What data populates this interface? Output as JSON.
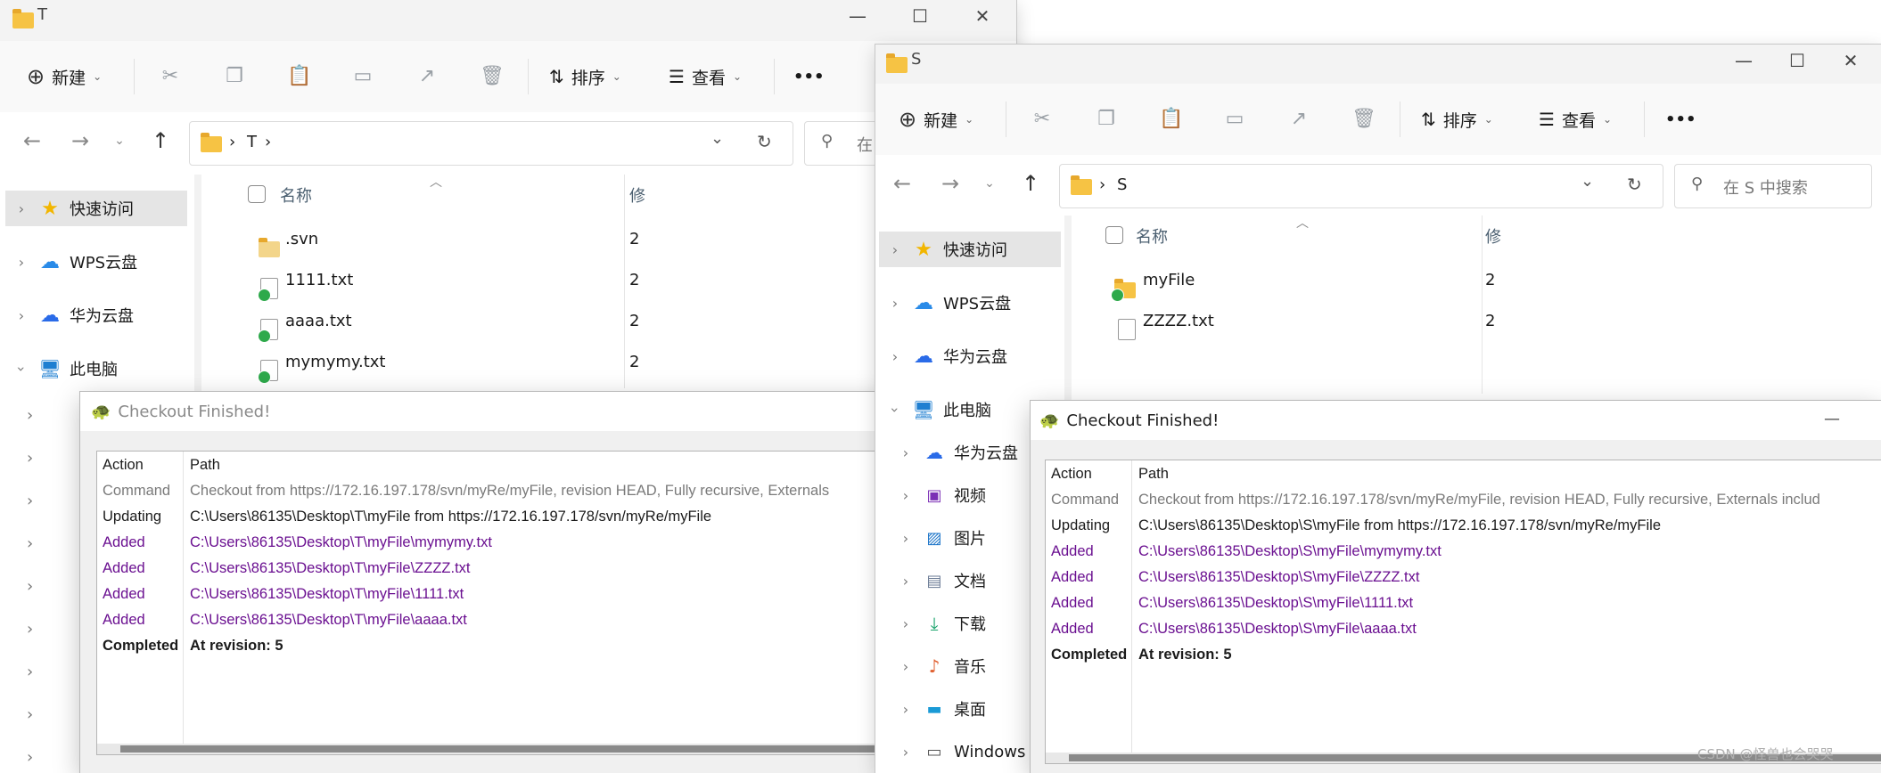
{
  "icons": {
    "new": "plus-circle-icon",
    "cut": "scissors-icon",
    "copy": "copy-icon",
    "paste": "paste-icon",
    "rename": "rename-icon",
    "share": "share-icon",
    "delete": "trash-icon",
    "sort": "sort-icon",
    "view": "view-icon",
    "more": "more-icon",
    "folder": "folder-icon",
    "tortoise": "tortoise-icon"
  },
  "explorerT": {
    "title": "T",
    "toolbar": {
      "new_label": "新建",
      "sort_label": "排序",
      "view_label": "查看",
      "more_label": "•••"
    },
    "window_controls": {
      "minimize": "—",
      "maximize": "☐",
      "close": "✕"
    },
    "address": {
      "crumb_sep": "›",
      "folder": "T",
      "trailing": "›"
    },
    "search_partial": "在",
    "sidebar": [
      {
        "label": "快速访问",
        "icon": "star-icon"
      },
      {
        "label": "WPS云盘",
        "icon": "cloud-icon"
      },
      {
        "label": "华为云盘",
        "icon": "cloud-icon"
      },
      {
        "label": "此电脑",
        "icon": "computer-icon"
      }
    ],
    "column_name": "名称",
    "column_partial": "修",
    "files": [
      {
        "name": ".svn",
        "type": "folder",
        "col2": "2"
      },
      {
        "name": "1111.txt",
        "type": "file",
        "col2": "2"
      },
      {
        "name": "aaaa.txt",
        "type": "file",
        "col2": "2"
      },
      {
        "name": "mymymy.txt",
        "type": "file",
        "col2": "2"
      }
    ]
  },
  "explorerS": {
    "title": "S",
    "toolbar": {
      "new_label": "新建",
      "sort_label": "排序",
      "view_label": "查看",
      "more_label": "•••"
    },
    "window_controls": {
      "minimize": "—",
      "maximize": "☐",
      "close": "✕"
    },
    "address": {
      "crumb_sep": "›",
      "folder": "S"
    },
    "search_placeholder": "在 S 中搜索",
    "sidebar": [
      {
        "label": "快速访问"
      },
      {
        "label": "WPS云盘"
      },
      {
        "label": "华为云盘"
      },
      {
        "label": "此电脑"
      },
      {
        "label": "华为云盘"
      },
      {
        "label": "视频"
      },
      {
        "label": "图片"
      },
      {
        "label": "文档"
      },
      {
        "label": "下载"
      },
      {
        "label": "音乐"
      },
      {
        "label": "桌面"
      },
      {
        "label": "Windows ("
      }
    ],
    "column_name": "名称",
    "column_partial": "修",
    "files": [
      {
        "name": "myFile",
        "type": "folder",
        "col2": "2"
      },
      {
        "name": "ZZZZ.txt",
        "type": "file",
        "col2": "2"
      }
    ]
  },
  "dialogT": {
    "title": "Checkout Finished!",
    "header": {
      "action": "Action",
      "path": "Path"
    },
    "rows": [
      {
        "action": "Command",
        "path": "Checkout from https://172.16.197.178/svn/myRe/myFile, revision HEAD, Fully recursive, Externals",
        "style": "muted"
      },
      {
        "action": "Updating",
        "path": "C:\\Users\\86135\\Desktop\\T\\myFile from https://172.16.197.178/svn/myRe/myFile",
        "style": "normal"
      },
      {
        "action": "Added",
        "path": "C:\\Users\\86135\\Desktop\\T\\myFile\\mymymy.txt",
        "style": "purple"
      },
      {
        "action": "Added",
        "path": "C:\\Users\\86135\\Desktop\\T\\myFile\\ZZZZ.txt",
        "style": "purple"
      },
      {
        "action": "Added",
        "path": "C:\\Users\\86135\\Desktop\\T\\myFile\\1111.txt",
        "style": "purple"
      },
      {
        "action": "Added",
        "path": "C:\\Users\\86135\\Desktop\\T\\myFile\\aaaa.txt",
        "style": "purple"
      },
      {
        "action": "Completed",
        "path": "At revision: 5",
        "style": "bold"
      }
    ]
  },
  "dialogS": {
    "title": "Checkout Finished!",
    "minimize": "—",
    "header": {
      "action": "Action",
      "path": "Path"
    },
    "rows": [
      {
        "action": "Command",
        "path": "Checkout from https://172.16.197.178/svn/myRe/myFile, revision HEAD, Fully recursive, Externals includ",
        "style": "muted"
      },
      {
        "action": "Updating",
        "path": "C:\\Users\\86135\\Desktop\\S\\myFile from https://172.16.197.178/svn/myRe/myFile",
        "style": "normal"
      },
      {
        "action": "Added",
        "path": "C:\\Users\\86135\\Desktop\\S\\myFile\\mymymy.txt",
        "style": "purple"
      },
      {
        "action": "Added",
        "path": "C:\\Users\\86135\\Desktop\\S\\myFile\\ZZZZ.txt",
        "style": "purple"
      },
      {
        "action": "Added",
        "path": "C:\\Users\\86135\\Desktop\\S\\myFile\\1111.txt",
        "style": "purple"
      },
      {
        "action": "Added",
        "path": "C:\\Users\\86135\\Desktop\\S\\myFile\\aaaa.txt",
        "style": "purple"
      },
      {
        "action": "Completed",
        "path": "At revision: 5",
        "style": "bold"
      }
    ]
  },
  "watermark": "CSDN @怪兽也会哭哭"
}
